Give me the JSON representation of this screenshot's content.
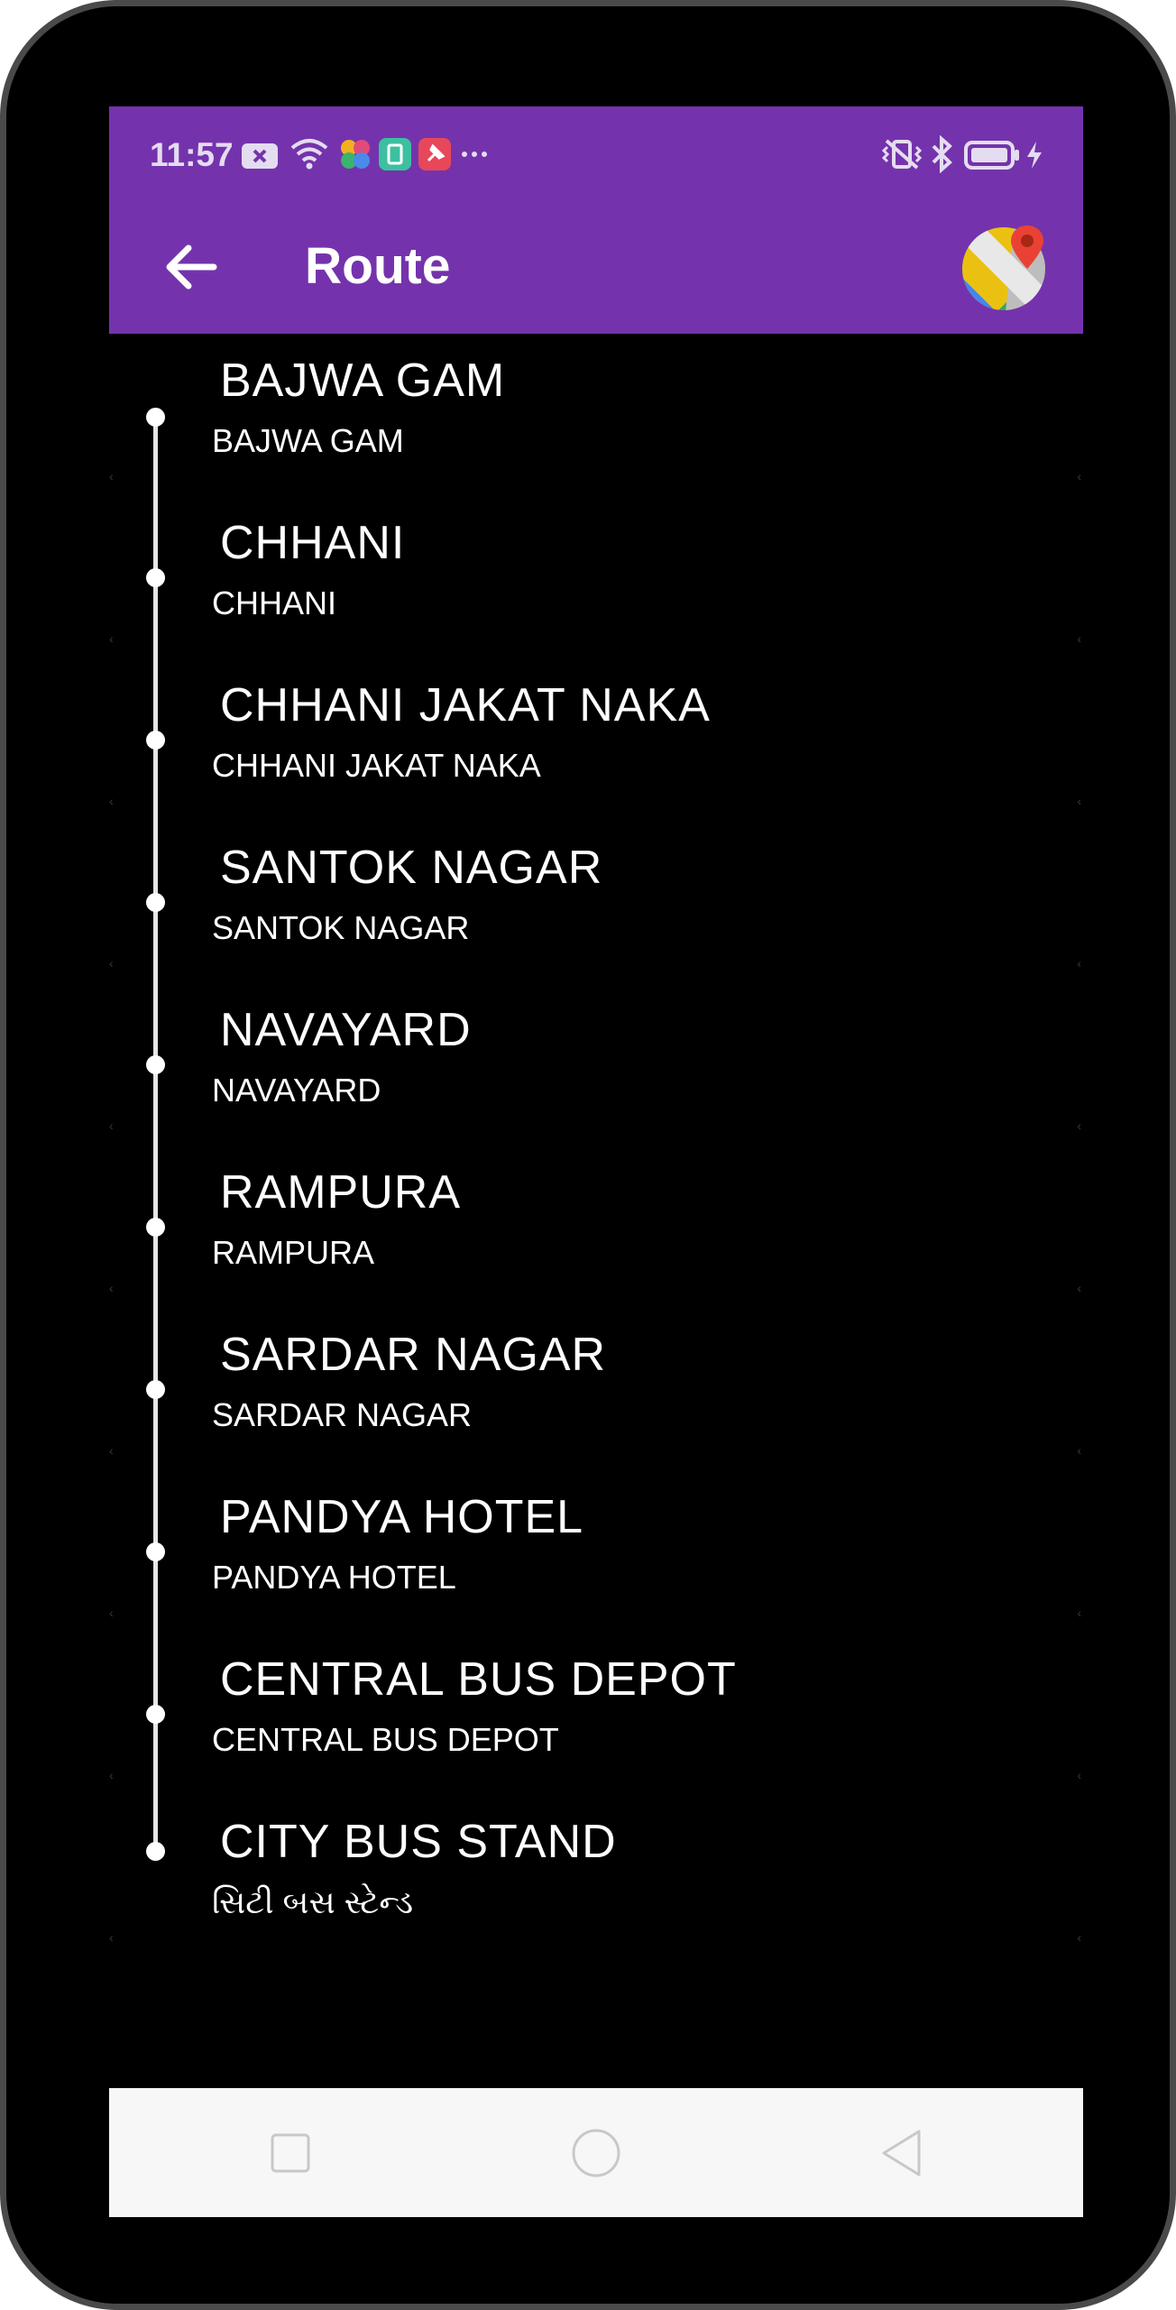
{
  "status_bar": {
    "time": "11:57",
    "icons": [
      "notification-x-icon",
      "wifi-icon",
      "pinwheel-app-icon",
      "app-icon",
      "pin-app-icon",
      "more-dots-icon",
      "vibrate-icon",
      "bluetooth-icon",
      "battery-icon",
      "charging-icon"
    ]
  },
  "app_bar": {
    "title": "Route",
    "back_icon": "arrow-left-icon",
    "map_icon": "google-maps-icon",
    "color": "#7433ac"
  },
  "route": {
    "stops": [
      {
        "name": "BAJWA GAM",
        "subtitle": "BAJWA GAM"
      },
      {
        "name": "CHHANI",
        "subtitle": "CHHANI"
      },
      {
        "name": "CHHANI JAKAT NAKA",
        "subtitle": "CHHANI JAKAT NAKA"
      },
      {
        "name": "SANTOK NAGAR",
        "subtitle": "SANTOK NAGAR"
      },
      {
        "name": "NAVAYARD",
        "subtitle": "NAVAYARD"
      },
      {
        "name": "RAMPURA",
        "subtitle": "RAMPURA"
      },
      {
        "name": "SARDAR NAGAR",
        "subtitle": "SARDAR NAGAR"
      },
      {
        "name": "PANDYA HOTEL",
        "subtitle": "PANDYA HOTEL"
      },
      {
        "name": "CENTRAL BUS DEPOT",
        "subtitle": "CENTRAL BUS DEPOT"
      },
      {
        "name": "CITY BUS STAND",
        "subtitle": "સિટી બસ સ્ટેન્ડ"
      }
    ]
  },
  "nav_bar": {
    "buttons": [
      "recents-square-icon",
      "home-circle-icon",
      "back-triangle-icon"
    ]
  }
}
